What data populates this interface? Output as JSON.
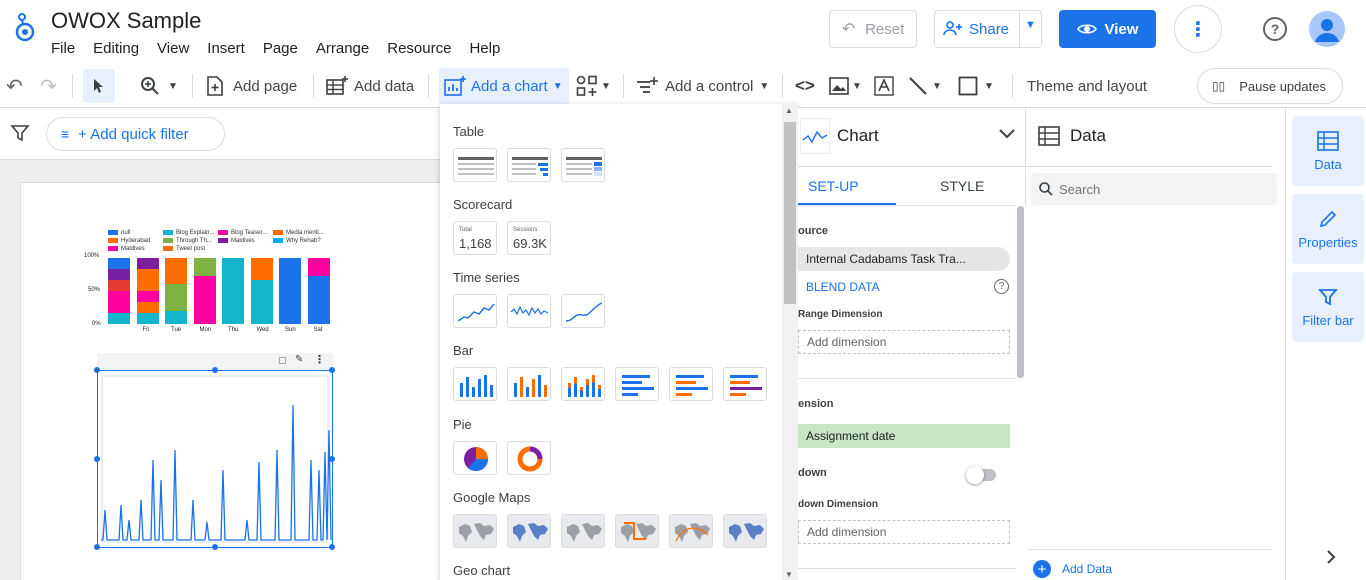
{
  "header": {
    "title": "OWOX Sample",
    "menu": [
      "File",
      "Editing",
      "View",
      "Insert",
      "Page",
      "Arrange",
      "Resource",
      "Help"
    ],
    "reset_label": "Reset",
    "share_label": "Share",
    "view_label": "View"
  },
  "toolbar": {
    "add_page": "Add page",
    "add_data": "Add data",
    "add_chart": "Add a chart",
    "add_control": "Add a control",
    "theme_layout": "Theme and layout",
    "pause_updates": "Pause updates"
  },
  "filterbar": {
    "quick_filter": "+ Add quick filter"
  },
  "colors": {
    "accent": "#1a73e8",
    "blue": "#1a73e8",
    "orange": "#ff6d00",
    "pink": "#ff00a0",
    "teal": "#12b5cb",
    "green": "#7cb342",
    "purple": "#7b1fa2"
  },
  "report": {
    "legend": [
      "null",
      "Blog Explain...",
      "Blog Teaser...",
      "Media menti...",
      "Hyderabad",
      "Through Th...",
      "Maldives",
      "Why Rehab?",
      "Maldives",
      "Tweet post"
    ],
    "yticks": [
      "100%",
      "50%",
      "0%"
    ],
    "xticks": [
      "Fri",
      "Tue",
      "Mon",
      "Thu",
      "Wed",
      "Sun",
      "Sat"
    ]
  },
  "chart_menu": {
    "sections": [
      "Table",
      "Scorecard",
      "Time series",
      "Bar",
      "Pie",
      "Google Maps",
      "Geo chart"
    ],
    "scorecard": [
      {
        "label": "Total",
        "value": "1,168"
      },
      {
        "label": "Sessions",
        "value": "69.3K"
      }
    ]
  },
  "chart_panel": {
    "title": "Chart",
    "tab_setup": "SET-UP",
    "tab_style": "STYLE",
    "source_label": "ource",
    "source_value": "Internal Cadabams Task Tra...",
    "blend_data": "BLEND DATA",
    "range_dimension": "Range Dimension",
    "add_dimension_1": "Add dimension",
    "dimension_label": "ension",
    "dimension_value": "Assignment date",
    "drilldown_label": "down",
    "drilldown_dimension": "down Dimension",
    "add_dimension_2": "Add dimension"
  },
  "data_panel": {
    "title": "Data",
    "search_placeholder": "Search",
    "add_data": "Add Data"
  },
  "rail": {
    "data": "Data",
    "properties": "Properties",
    "filter_bar": "Filter bar"
  }
}
